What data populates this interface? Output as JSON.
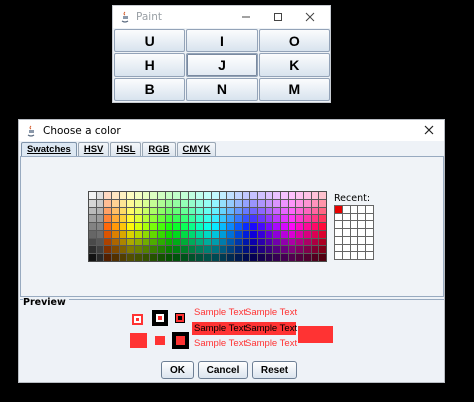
{
  "paint_window": {
    "title": "Paint",
    "keys": [
      "U",
      "I",
      "O",
      "H",
      "J",
      "K",
      "B",
      "N",
      "M"
    ]
  },
  "dialog": {
    "title": "Choose a color",
    "tabs": [
      {
        "label": "Swatches",
        "active": true
      },
      {
        "label": "HSV",
        "active": false
      },
      {
        "label": "HSL",
        "active": false
      },
      {
        "label": "RGB",
        "active": false
      },
      {
        "label": "CMYK",
        "active": false
      }
    ],
    "recent_label": "Recent:",
    "preview_label": "Preview",
    "sample_text": "Sample Text",
    "selected_color": "#ff3333",
    "buttons": {
      "ok": "OK",
      "cancel": "Cancel",
      "reset": "Reset"
    }
  },
  "colors": {
    "window_bg": "#eef2f7",
    "button_border": "#93a3b8",
    "accent": "#ff3333"
  }
}
